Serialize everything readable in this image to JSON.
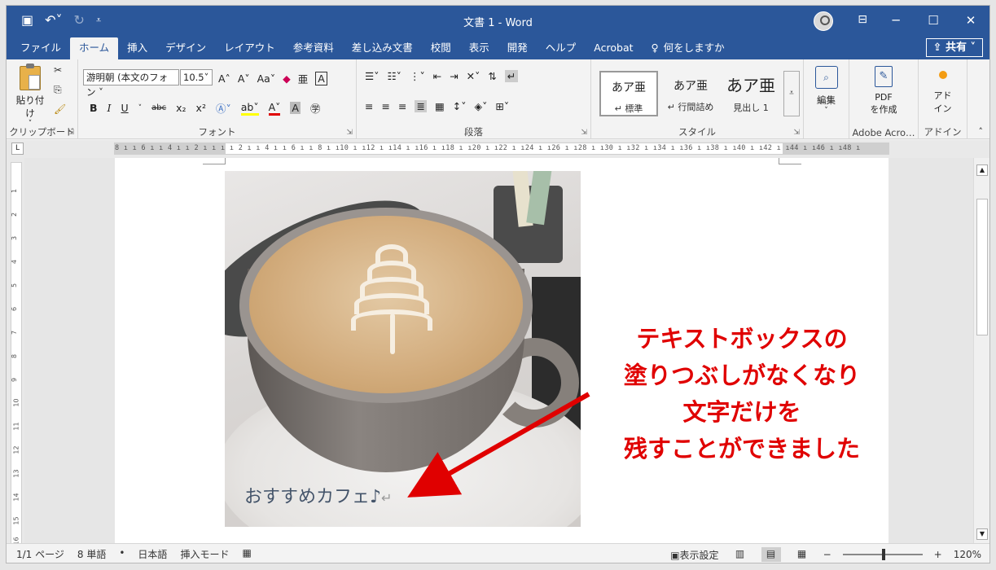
{
  "window": {
    "title": "文書 1 - Word",
    "share_label": "共有",
    "search_label": "何をしますか"
  },
  "tabs": [
    "ファイル",
    "ホーム",
    "挿入",
    "デザイン",
    "レイアウト",
    "参考資料",
    "差し込み文書",
    "校閲",
    "表示",
    "開発",
    "ヘルプ",
    "Acrobat"
  ],
  "active_tab": "ホーム",
  "ribbon": {
    "clipboard": {
      "label": "クリップボード",
      "paste": "貼り付け"
    },
    "font": {
      "label": "フォント",
      "name": "游明朝 (本文のフォン",
      "size": "10.5",
      "aa": "Aa"
    },
    "paragraph": {
      "label": "段落"
    },
    "styles": {
      "label": "スタイル",
      "items": [
        {
          "preview": "あア亜",
          "name": "↵ 標準"
        },
        {
          "preview": "あア亜",
          "name": "↵ 行間詰め"
        },
        {
          "preview": "あア亜",
          "name": "見出し 1"
        }
      ]
    },
    "edit": {
      "label": "編集"
    },
    "adobe": {
      "label": "Adobe Acro…",
      "pdf_line1": "PDF",
      "pdf_line2": "を作成"
    },
    "addin": {
      "label": "アドイン",
      "btn_line1": "アド",
      "btn_line2": "イン"
    }
  },
  "ruler": {
    "h_text": "8 ı  ı 6 ı  ı 4 ı  ı 2 ı  ı     ı  ı 2 ı  ı 4 ı  ı 6 ı  ı 8 ı  ı10 ı  ı12 ı  ı14 ı  ı16 ı  ı18 ı  ı20 ı  ı22 ı  ı24 ı  ı26 ı  ı28 ı  ı30 ı  ı32 ı  ı34 ı  ı36 ı  ı38 ı  ı40 ı  ı42 ı  ı44 ı  ı46 ı  ı48 ı",
    "v_numbers": [
      "1",
      "2",
      "3",
      "4",
      "5",
      "6",
      "7",
      "8",
      "9",
      "10",
      "11",
      "12",
      "13",
      "14",
      "15",
      "16"
    ]
  },
  "document": {
    "caption": "おすすめカフェ♪",
    "callout_lines": [
      "テキストボックスの",
      "塗りつぶしがなくなり",
      "文字だけを",
      "残すことができました"
    ],
    "accent_color": "#e00000"
  },
  "status": {
    "page": "1/1 ページ",
    "words": "8 単語",
    "language": "日本語",
    "mode": "挿入モード",
    "display_settings": "表示設定",
    "zoom": "120%"
  }
}
